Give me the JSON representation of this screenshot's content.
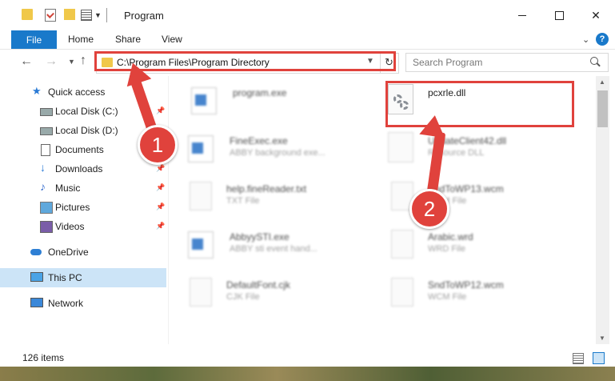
{
  "window": {
    "title": "Program"
  },
  "ribbon": {
    "file": "File",
    "home": "Home",
    "share": "Share",
    "view": "View",
    "help": "?"
  },
  "address": {
    "path": "C:\\Program Files\\Program Directory",
    "search_placeholder": "Search Program"
  },
  "sidebar": {
    "items": [
      {
        "label": "Quick access"
      },
      {
        "label": "Local Disk (C:)"
      },
      {
        "label": "Local Disk (D:)"
      },
      {
        "label": "Documents"
      },
      {
        "label": "Downloads"
      },
      {
        "label": "Music"
      },
      {
        "label": "Pictures"
      },
      {
        "label": "Videos"
      },
      {
        "label": "OneDrive"
      },
      {
        "label": "This PC"
      },
      {
        "label": "Network"
      }
    ]
  },
  "files": [
    {
      "name": "program.exe",
      "desc": ""
    },
    {
      "name": "pcxrle.dll",
      "desc": ""
    },
    {
      "name": "FineExec.exe",
      "desc": "ABBY background exe..."
    },
    {
      "name": "UpdateClient42.dll",
      "desc": "Resource DLL"
    },
    {
      "name": "help.fineReader.txt",
      "desc": "TXT File"
    },
    {
      "name": "SndToWP13.wcm",
      "desc": "WCM File"
    },
    {
      "name": "AbbyySTI.exe",
      "desc": "ABBY sti event hand..."
    },
    {
      "name": "Arabic.wrd",
      "desc": "WRD File"
    },
    {
      "name": "DefaultFont.cjk",
      "desc": "CJK File"
    },
    {
      "name": "SndToWP12.wcm",
      "desc": "WCM File"
    }
  ],
  "status": {
    "items": "126 items"
  },
  "annotations": {
    "step1": "1",
    "step2": "2"
  },
  "colors": {
    "accent": "#1979ca",
    "highlight": "#e0423c",
    "selected": "#cce4f7"
  }
}
